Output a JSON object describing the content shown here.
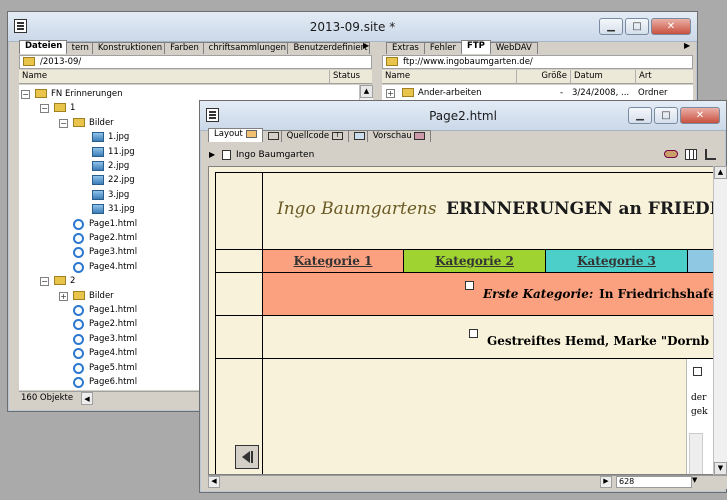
{
  "site_window": {
    "title": "2013-09.site *",
    "left_tabs": [
      "Dateien",
      "tern",
      "Konstruktionen",
      "Farben",
      "chriftsammlungen",
      "Benutzerdefiniert"
    ],
    "right_tabs": [
      "Extras",
      "Fehler",
      "FTP",
      "WebDAV"
    ],
    "left_path": "/2013-09/",
    "right_path": "ftp://www.ingobaumgarten.de/",
    "left_columns": [
      "Name",
      "Status"
    ],
    "right_columns": [
      "Name",
      "Größe",
      "Datum",
      "Art"
    ],
    "tree": [
      {
        "label": "FN Erinnerungen",
        "type": "folder"
      },
      {
        "label": "1",
        "type": "folder"
      },
      {
        "label": "Bilder",
        "type": "folder"
      },
      {
        "label": "1.jpg",
        "type": "image"
      },
      {
        "label": "11.jpg",
        "type": "image"
      },
      {
        "label": "2.jpg",
        "type": "image"
      },
      {
        "label": "22.jpg",
        "type": "image"
      },
      {
        "label": "3.jpg",
        "type": "image"
      },
      {
        "label": "31.jpg",
        "type": "image"
      },
      {
        "label": "Page1.html",
        "type": "html"
      },
      {
        "label": "Page2.html",
        "type": "html"
      },
      {
        "label": "Page3.html",
        "type": "html"
      },
      {
        "label": "Page4.html",
        "type": "html"
      },
      {
        "label": "2",
        "type": "folder"
      },
      {
        "label": "Bilder",
        "type": "folder"
      },
      {
        "label": "Page1.html",
        "type": "html"
      },
      {
        "label": "Page2.html",
        "type": "html"
      },
      {
        "label": "Page3.html",
        "type": "html"
      },
      {
        "label": "Page4.html",
        "type": "html"
      },
      {
        "label": "Page5.html",
        "type": "html"
      },
      {
        "label": "Page6.html",
        "type": "html"
      }
    ],
    "ftp_row": {
      "name": "Ander-arbeiten",
      "size": "-",
      "date": "3/24/2008, ...",
      "kind": "Ordner"
    },
    "status_count": "160 Objekte"
  },
  "page_window": {
    "title": "Page2.html",
    "tabs": [
      "Layout",
      "Quellcode",
      "Vorschau"
    ],
    "breadcrumb": "Ingo Baumgarten",
    "heading_italic": "Ingo Baumgartens",
    "heading_bold": "ERINNERUNGEN an FRIEDRIC",
    "nav": [
      "Kategorie 1",
      "Kategorie 2",
      "Kategorie 3"
    ],
    "category_italic": "Erste Kategorie:",
    "category_text": "In Friedrichshafen",
    "item_text": "Gestreiftes Hemd, Marke \"Dornb",
    "side_text_1": "der",
    "side_text_2": "gek",
    "zoom_value": "628"
  },
  "colors": {
    "page_bg": "#f7f2d9",
    "heading_italic": "#6b5a25",
    "nav1": "#fca180",
    "nav2": "#9ed331",
    "nav3": "#4ccfc8",
    "nav4": "#8ec8e2",
    "category_bar": "#fca180"
  }
}
